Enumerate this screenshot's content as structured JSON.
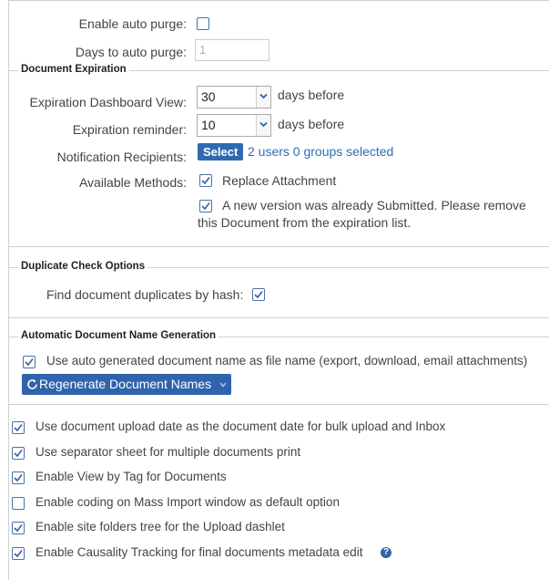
{
  "auto_purge": {
    "enable_label": "Enable auto purge:",
    "enable_checked": false,
    "days_label": "Days to auto purge:",
    "days_value": "1"
  },
  "document_expiration": {
    "legend": "Document Expiration",
    "dashboard_label": "Expiration Dashboard View:",
    "dashboard_value": "30",
    "dashboard_suffix": "days before",
    "reminder_label": "Expiration reminder:",
    "reminder_value": "10",
    "reminder_suffix": "days before",
    "recipients_label": "Notification Recipients:",
    "select_button": "Select",
    "recipients_summary": "2 users 0 groups selected",
    "methods_label": "Available Methods:",
    "method_replace": "Replace Attachment",
    "method_replace_checked": true,
    "method_new_version_line1": "A new version was already Submitted. Please remove",
    "method_new_version_line2": "this Document from the expiration list.",
    "method_new_version_checked": true
  },
  "duplicate_check": {
    "legend": "Duplicate Check Options",
    "hash_label": "Find document duplicates by hash:",
    "hash_checked": true
  },
  "name_generation": {
    "legend": "Automatic Document Name Generation",
    "use_auto_label": "Use auto generated document name as file name (export, download, email attachments)",
    "use_auto_checked": true,
    "regenerate_button": "Regenerate Document Names"
  },
  "options": [
    {
      "label": "Use document upload date as the document date for bulk upload and Inbox",
      "checked": true
    },
    {
      "label": "Use separator sheet for multiple documents print",
      "checked": true
    },
    {
      "label": "Enable View by Tag for Documents",
      "checked": true
    },
    {
      "label": "Enable coding on Mass Import window as default option",
      "checked": false
    },
    {
      "label": "Enable site folders tree for the Upload dashlet",
      "checked": true
    },
    {
      "label": "Enable Causality Tracking for final documents metadata edit",
      "checked": true
    }
  ],
  "icons": {
    "checkmark": "check-icon",
    "dropdown": "chevron-down-icon",
    "refresh": "refresh-icon",
    "help": "help-icon"
  },
  "colors": {
    "accent": "#2f64ad",
    "link": "#2e6db4",
    "checkbox_border": "#4a6fa8"
  }
}
